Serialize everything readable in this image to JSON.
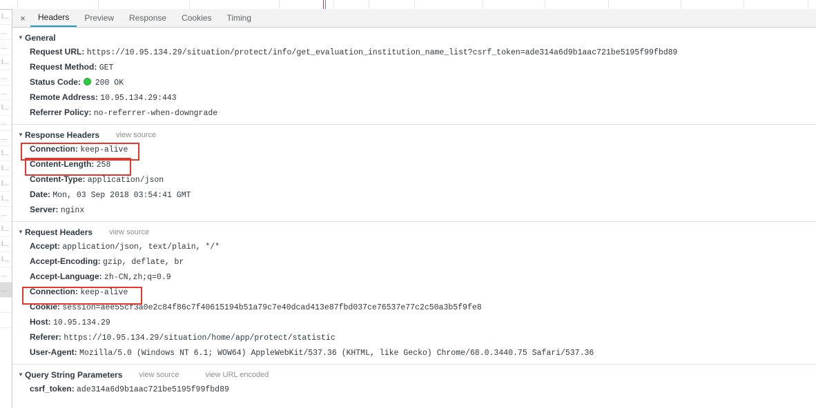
{
  "panel": {
    "name": "chrome-devtools-network-headers"
  },
  "tabs": {
    "close_label": "×",
    "items": [
      {
        "label": "Headers",
        "active": true
      },
      {
        "label": "Preview",
        "active": false
      },
      {
        "label": "Response",
        "active": false
      },
      {
        "label": "Cookies",
        "active": false
      },
      {
        "label": "Timing",
        "active": false
      }
    ]
  },
  "common": {
    "twisty": "▼",
    "view_source": "view source",
    "view_url_encoded": "view URL encoded"
  },
  "sections": {
    "general": {
      "title": "General",
      "rows": [
        {
          "key": "Request URL:",
          "value": "https://10.95.134.29/situation/protect/info/get_evaluation_institution_name_list?csrf_token=ade314a6d9b1aac721be5195f99fbd89"
        },
        {
          "key": "Request Method:",
          "value": "GET"
        },
        {
          "key": "Status Code:",
          "value": "200 OK",
          "status_icon": "green-dot-icon"
        },
        {
          "key": "Remote Address:",
          "value": "10.95.134.29:443"
        },
        {
          "key": "Referrer Policy:",
          "value": "no-referrer-when-downgrade"
        }
      ]
    },
    "response_headers": {
      "title": "Response Headers",
      "rows": [
        {
          "key": "Connection:",
          "value": "keep-alive",
          "highlighted": true
        },
        {
          "key": "Content-Length:",
          "value": "258",
          "highlighted": true
        },
        {
          "key": "Content-Type:",
          "value": "application/json"
        },
        {
          "key": "Date:",
          "value": "Mon, 03 Sep 2018 03:54:41 GMT"
        },
        {
          "key": "Server:",
          "value": "nginx"
        }
      ]
    },
    "request_headers": {
      "title": "Request Headers",
      "rows": [
        {
          "key": "Accept:",
          "value": "application/json, text/plain, */*"
        },
        {
          "key": "Accept-Encoding:",
          "value": "gzip, deflate, br"
        },
        {
          "key": "Accept-Language:",
          "value": "zh-CN,zh;q=0.9"
        },
        {
          "key": "Connection:",
          "value": "keep-alive",
          "highlighted": true
        },
        {
          "key": "Cookie:",
          "value": "session=aee55cf3a0e2c84f86c7f40615194b51a79c7e40dcad413e87fbd037ce76537e77c2c50a3b5f9fe8"
        },
        {
          "key": "Host:",
          "value": "10.95.134.29"
        },
        {
          "key": "Referer:",
          "value": "https://10.95.134.29/situation/home/app/protect/statistic"
        },
        {
          "key": "User-Agent:",
          "value": "Mozilla/5.0 (Windows NT 6.1; WOW64) AppleWebKit/537.36 (KHTML, like Gecko) Chrome/68.0.3440.75 Safari/537.36"
        }
      ]
    },
    "query_string": {
      "title": "Query String Parameters",
      "rows": [
        {
          "key": "csrf_token:",
          "value": "ade314a6d9b1aac721be5195f99fbd89"
        }
      ]
    }
  },
  "request_list": {
    "rows": [
      {
        "label": "l..."
      },
      {
        "label": "..."
      },
      {
        "label": "..."
      },
      {
        "label": "l..."
      },
      {
        "label": "..."
      },
      {
        "label": "..."
      },
      {
        "label": "l..."
      },
      {
        "label": "..."
      },
      {
        "label": "..."
      },
      {
        "label": "l..."
      },
      {
        "label": "l..."
      },
      {
        "label": "l..."
      },
      {
        "label": "l..."
      },
      {
        "label": "..."
      },
      {
        "label": "l..."
      },
      {
        "label": "l..."
      },
      {
        "label": "l..."
      },
      {
        "label": "..."
      },
      {
        "label": "...",
        "selected": true
      },
      {
        "label": ""
      },
      {
        "label": ""
      }
    ]
  },
  "colors": {
    "accent_tab": "#1a9cd8",
    "annotation": "#e8352a",
    "status_ok": "#2ecc40",
    "text": "#303942",
    "muted": "#8e8e8e"
  }
}
